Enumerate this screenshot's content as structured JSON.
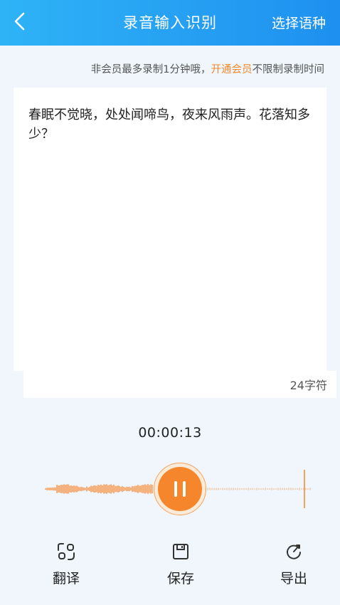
{
  "header": {
    "title": "录音输入识别",
    "language_button": "选择语种"
  },
  "notice": {
    "prefix": "非会员最多录制1分钟哦，",
    "link": "开通会员",
    "suffix": "不限制录制时间"
  },
  "transcript": {
    "text": "春眠不觉晓，处处闻啼鸟，夜来风雨声。花落知多少？",
    "char_count": "24字符"
  },
  "recorder": {
    "timer": "00:00:13",
    "state": "recording"
  },
  "colors": {
    "header_start": "#2fb3f6",
    "header_end": "#1e90f0",
    "accent": "#f5862c",
    "vip_link": "#f08a2e",
    "background": "#f0f6fc"
  },
  "actions": [
    {
      "label": "翻译",
      "icon": "translate-icon"
    },
    {
      "label": "保存",
      "icon": "save-icon"
    },
    {
      "label": "导出",
      "icon": "export-icon"
    }
  ]
}
